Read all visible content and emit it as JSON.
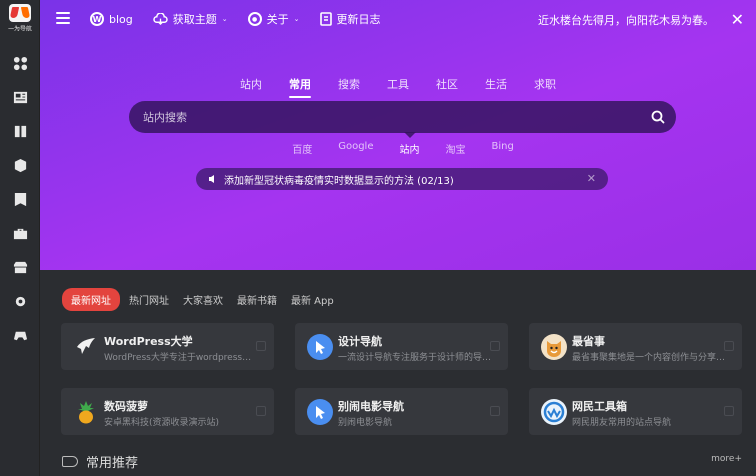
{
  "brand": {
    "logo_text": "一为导航"
  },
  "topbar": {
    "nav": [
      {
        "label": "blog",
        "icon": "wordpress-icon"
      },
      {
        "label": "获取主题",
        "icon": "cloud-download-icon",
        "dropdown": true
      },
      {
        "label": "关于",
        "icon": "circle-icon",
        "dropdown": true
      },
      {
        "label": "更新日志",
        "icon": "document-icon"
      }
    ],
    "motto": "近水楼台先得月，向阳花木易为春。"
  },
  "search": {
    "tabs": [
      "站内",
      "常用",
      "搜索",
      "工具",
      "社区",
      "生活",
      "求职"
    ],
    "active_tab": "常用",
    "placeholder": "站内搜索",
    "engines": [
      "百度",
      "Google",
      "站内",
      "淘宝",
      "Bing"
    ],
    "active_engine": "站内"
  },
  "notice": {
    "text": "添加新型冠状病毒疫情实时数据显示的方法 (02/13)"
  },
  "categories": {
    "tabs": [
      "最新网址",
      "热门网址",
      "大家喜欢",
      "最新书籍",
      "最新 App"
    ],
    "active": "最新网址"
  },
  "cards": [
    {
      "title": "WordPress大学",
      "desc": "WordPress大学专注于wordpress建站教程",
      "icon": "wordpress-university-icon",
      "color": "#2b2d31"
    },
    {
      "title": "设计导航",
      "desc": "一流设计导航专注服务于设计师的导航网站",
      "icon": "pointer-hand-icon",
      "color": "#4a8ef0"
    },
    {
      "title": "最省事",
      "desc": "最省事聚集地是一个内容创作与分享社区",
      "icon": "shiba-dog-icon",
      "color": "#f0a040"
    },
    {
      "title": "数码菠萝",
      "desc": "安卓黑科技(资源收录演示站)",
      "icon": "pineapple-icon",
      "color": "#e8a020"
    },
    {
      "title": "别闹电影导航",
      "desc": "别闹电影导航",
      "icon": "pointer-hand-icon",
      "color": "#4a8ef0"
    },
    {
      "title": "网民工具箱",
      "desc": "网民朋友常用的站点导航",
      "icon": "wave-logo-icon",
      "color": "#2a7fd4"
    }
  ],
  "section": {
    "title": "常用推荐",
    "more": "more+"
  },
  "colors": {
    "hero_start": "#7a33e8",
    "hero_end": "#a534f0",
    "accent": "#e3443e"
  }
}
